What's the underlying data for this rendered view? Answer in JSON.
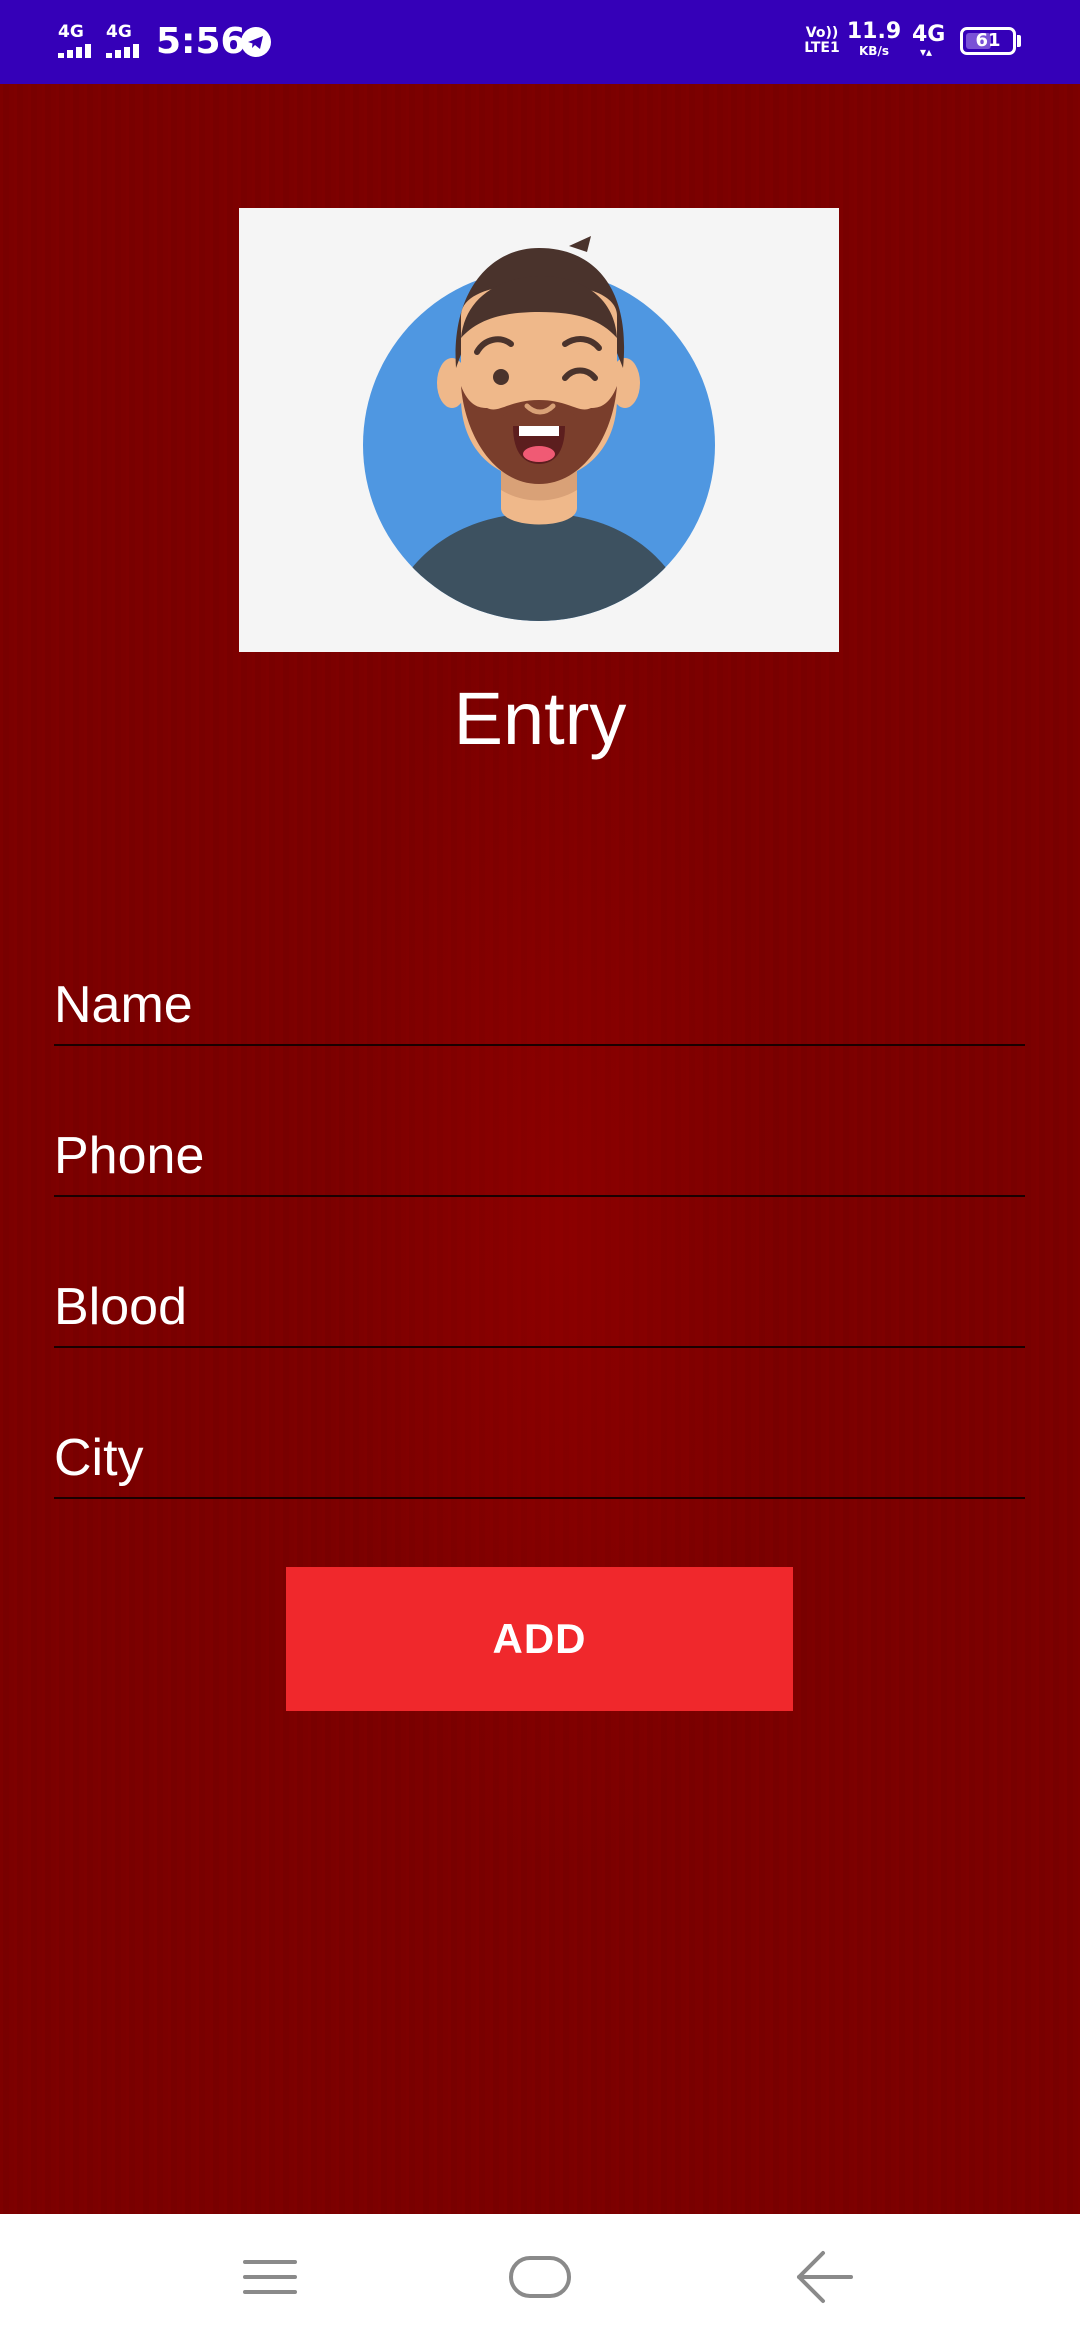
{
  "status_bar": {
    "signal_1": "4G",
    "signal_2": "4G",
    "time": "5:56",
    "telegram_icon": "telegram-icon",
    "volte_line1": "Vo))",
    "volte_line2": "LTE1",
    "net_speed_value": "11.9",
    "net_speed_unit": "KB/s",
    "network": "4G",
    "network_arrows": "▾▴",
    "battery_level": "61",
    "battery_fraction": 0.61
  },
  "colors": {
    "status_bar_bg": "#3500b8",
    "main_bg": "#7b0000",
    "button_bg": "#f0282c",
    "avatar_circle": "#4f97e1",
    "shirt": "#3d5160",
    "skin": "#efb88a",
    "beard": "#7a3e2c",
    "hair": "#4a332c"
  },
  "screen": {
    "title": "Entry",
    "avatar_icon": "avatar-illustration"
  },
  "form": {
    "name_placeholder": "Name",
    "phone_placeholder": "Phone",
    "blood_placeholder": "Blood",
    "city_placeholder": "City",
    "add_label": "ADD"
  },
  "nav_bar": {
    "menu_icon": "menu-icon",
    "home_icon": "home-icon",
    "back_icon": "back-arrow-icon"
  }
}
